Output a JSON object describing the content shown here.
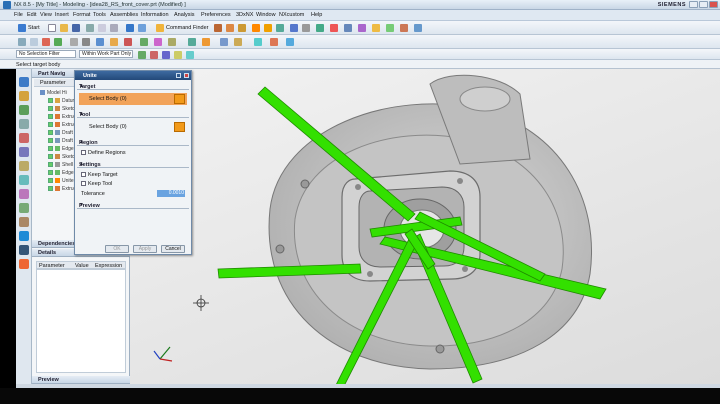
{
  "window": {
    "title": "NX 8.5 - [My Title] - Modeling - [idea28_RS_front_cover.prt (Modified) ]",
    "brand": "SIEMENS"
  },
  "menu": [
    "File",
    "Edit",
    "View",
    "Insert",
    "Format",
    "Tools",
    "Assemblies",
    "Information",
    "Analysis",
    "Preferences",
    "3DxNX",
    "Window",
    "NXcustom",
    "Help"
  ],
  "toolbar": {
    "start_label": "Start",
    "command_finder": "Command Finder",
    "selection_filter": "No Selection Filter",
    "scope": "Within Work Part Only"
  },
  "cue_line": "Select target body",
  "navigator": {
    "title": "Part Navig",
    "model_history": "Model Hi",
    "items": [
      "Datum",
      "Sketch",
      "Extrud",
      "Extrud",
      "Draft",
      "Draft",
      "Edge",
      "Sketch",
      "Shell",
      "Edge",
      "Unite",
      "Extrud"
    ],
    "dependencies": "Dependencies",
    "details": "Details",
    "columns": [
      "Parameter",
      "Value",
      "Expression"
    ],
    "preview": "Preview"
  },
  "dialog": {
    "title": "Unite",
    "target": {
      "section": "Target",
      "select": "Select Body (0)"
    },
    "tool": {
      "section": "Tool",
      "select": "Select Body (0)"
    },
    "region": {
      "section": "Region",
      "define": "Define Regions"
    },
    "settings": {
      "section": "Settings",
      "keep_target": "Keep Target",
      "keep_tool": "Keep Tool",
      "tolerance_label": "Tolerance",
      "tolerance_value": "0.0010"
    },
    "preview": {
      "section": "Preview"
    },
    "buttons": {
      "ok": "OK",
      "apply": "Apply",
      "cancel": "Cancel"
    }
  },
  "colors": {
    "accent": "#2e5a8f",
    "select_highlight": "#f2a35a",
    "green_body": "#33e000",
    "part_gray": "#c8c8c8"
  },
  "icons": [
    "start-icon",
    "new-icon",
    "open-icon",
    "save-icon",
    "undo-icon",
    "redo-icon",
    "unite-icon",
    "sketch-icon",
    "extrude-icon",
    "crosshair-icon",
    "csys-triad-icon"
  ]
}
